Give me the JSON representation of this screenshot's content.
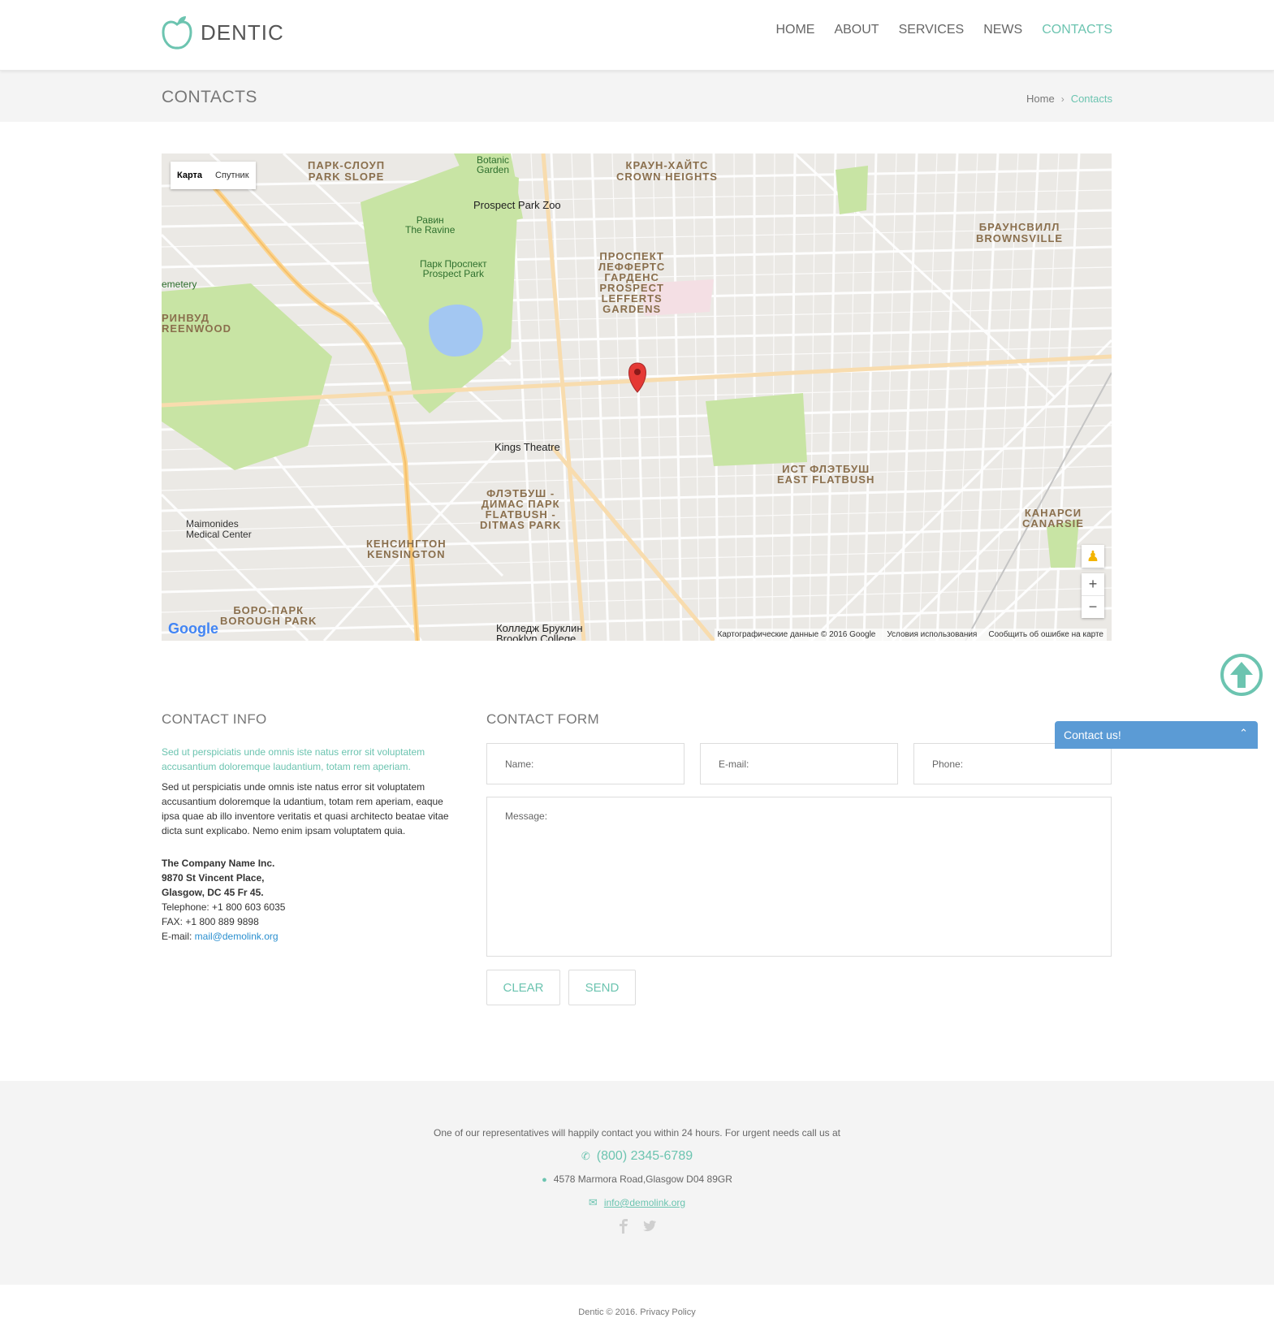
{
  "brand": {
    "name": "DENTIC",
    "accent": "#6cc4b0"
  },
  "nav": {
    "items": [
      {
        "label": "HOME"
      },
      {
        "label": "ABOUT"
      },
      {
        "label": "SERVICES"
      },
      {
        "label": "NEWS"
      },
      {
        "label": "CONTACTS",
        "active": true
      }
    ]
  },
  "titlebar": {
    "title": "CONTACTS",
    "breadcrumb": {
      "home": "Home",
      "sep": "›",
      "current": "Contacts"
    }
  },
  "map": {
    "type_map": "Карта",
    "type_satellite": "Спутник",
    "google": "Google",
    "attribution": "Картографические данные © 2016 Google",
    "terms": "Условия использования",
    "report": "Сообщить об ошибке на карте",
    "zoom_in": "+",
    "zoom_out": "−",
    "labels": {
      "park_slope": "ПАРК-СЛОУП\nPARK SLOPE",
      "crown_heights": "КРАУН-ХАЙТС\nCROWN HEIGHTS",
      "zoo": "Prospect Park Zoo",
      "ravine": "Равин\nThe Ravine",
      "prospect_park": "Парк Проспект\nProspect Park",
      "lefferts": "ПРОСПЕКТ\nЛЕФФЕРТС\nГАРДЕНС\nPROSPECT\nLEFFERTS\nGARDENS",
      "brownsville": "БРАУНСВИЛЛ\nBROWNSVILLE",
      "greenwood": "РИНВУД\nREENWOOD",
      "cemetery": "emetery",
      "kings": "Kings Theatre",
      "flatbush": "ФЛЭТБУШ -\nДИМАС ПАРК\nFLATBUSH -\nDITMAS PARK",
      "east_flatbush": "ИСТ ФЛЭТБУШ\nEAST FLATBUSH",
      "maimonides": "Maimonides\nMedical Center",
      "kensington": "КЕНСИНГТОН\nKENSINGTON",
      "boro_park": "БОРО-ПАРК\nBOROUGH PARK",
      "college": "Колледж Бруклин\nBrooklyn College",
      "canarsie": "КАНАРСИ\nCANARSIE",
      "botanic": "Botanic\nGarden"
    }
  },
  "contact_info": {
    "title": "CONTACT INFO",
    "lead": "Sed ut perspiciatis unde omnis iste natus error sit voluptatem accusantium doloremque laudantium, totam rem aperiam.",
    "body": "Sed ut perspiciatis unde omnis iste natus error sit voluptatem accusantium doloremque la udantium, totam rem aperiam, eaque ipsa quae ab illo inventore veritatis et quasi architecto beatae vitae dicta sunt explicabo. Nemo enim ipsam voluptatem quia.",
    "company": "The Company Name Inc.",
    "street": "9870 St Vincent Place,",
    "city": "Glasgow, DC 45 Fr 45.",
    "telephone": "Telephone: +1 800 603 6035",
    "fax": "FAX: +1 800 889 9898",
    "email_label": "E-mail: ",
    "email": "mail@demolink.org"
  },
  "contact_form": {
    "title": "CONTACT FORM",
    "name_placeholder": "Name:",
    "email_placeholder": "E-mail:",
    "phone_placeholder": "Phone:",
    "message_placeholder": "Message:",
    "clear": "CLEAR",
    "send": "SEND"
  },
  "widget": {
    "label": "Contact us!",
    "chevron": "⌃"
  },
  "footer": {
    "line1": "One of our representatives will happily contact you within 24 hours. For urgent needs call us at",
    "phone": "(800) 2345-6789",
    "address": "4578 Marmora Road,Glasgow D04 89GR",
    "email": "info@demolink.org",
    "copyright": "Dentic © 2016.",
    "privacy": "Privacy Policy"
  }
}
